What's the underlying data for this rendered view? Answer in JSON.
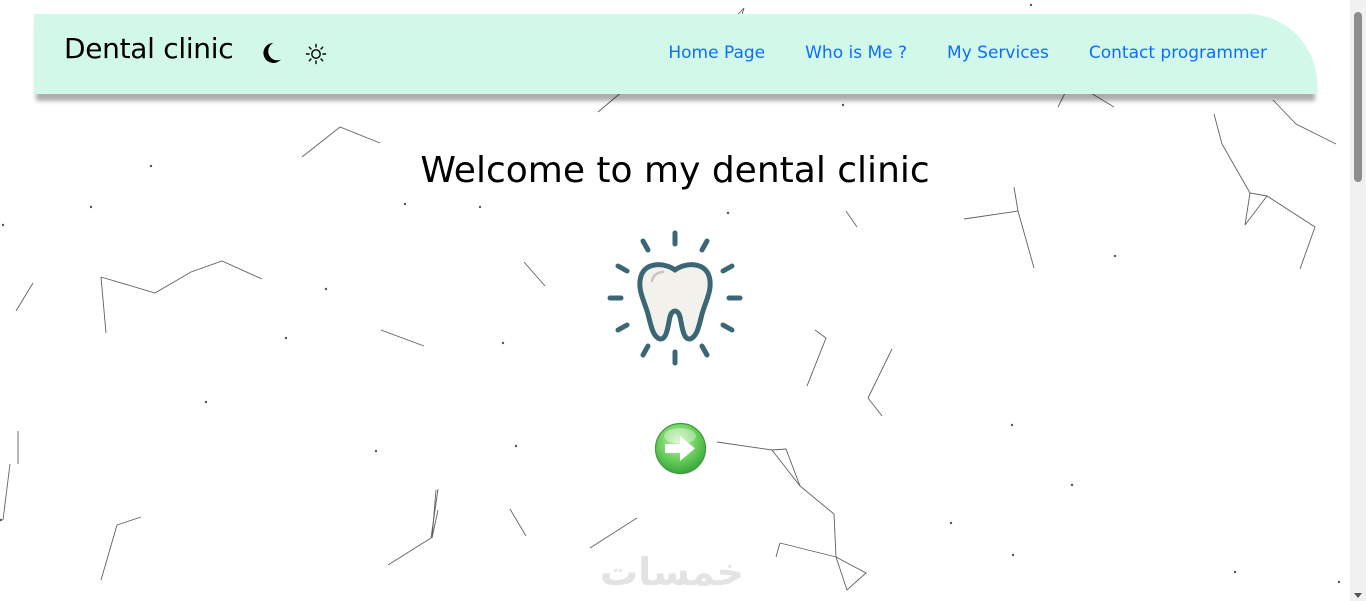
{
  "header": {
    "brand": "Dental clinic",
    "theme_toggle": {
      "dark_icon": "moon-icon",
      "light_icon": "sun-icon"
    },
    "nav": [
      {
        "label": "Home Page"
      },
      {
        "label": "Who is Me ?"
      },
      {
        "label": "My Services"
      },
      {
        "label": "Contact programmer"
      }
    ]
  },
  "main": {
    "title": "Welcome to my dental clinic",
    "hero_icon": "tooth-icon",
    "action_icon": "arrow-right-icon"
  },
  "watermark": "خمسات",
  "colors": {
    "navbar_bg": "#d1f8e8",
    "link": "#0d6efd",
    "tooth_outline": "#3b6775",
    "button_green": "#5ec85a"
  }
}
